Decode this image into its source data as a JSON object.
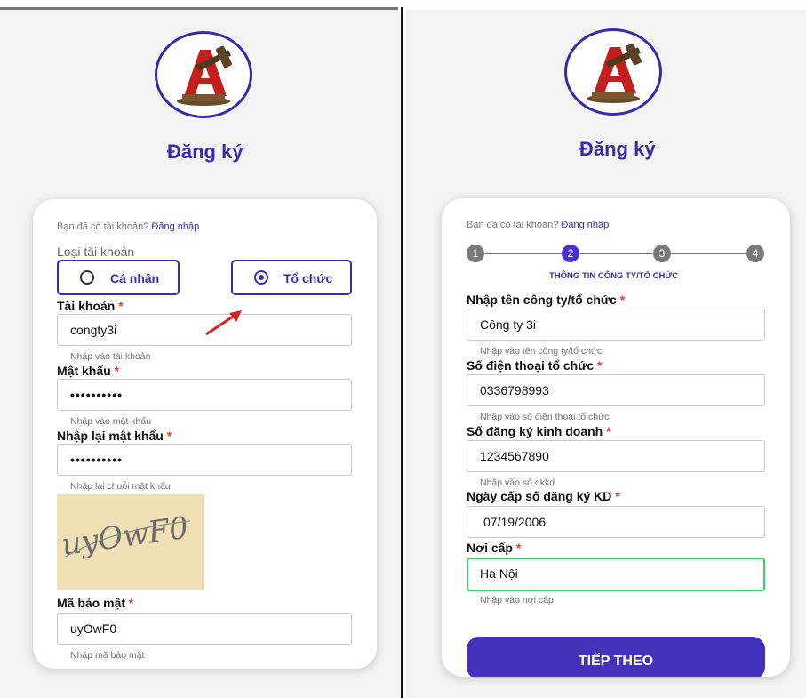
{
  "left": {
    "title": "Đăng ký",
    "login_prompt": "Bạn đã có tài khoản?",
    "login_link": "Đăng nhập",
    "account_type_label": "Loại tài khoản",
    "radio_individual": "Cá nhân",
    "radio_organization": "Tổ chức",
    "selected_account_type": "Tổ chức",
    "username_label": "Tài khoản",
    "username_value": "congty3i",
    "username_help": "Nhập vào tài khoản",
    "password_label": "Mật khẩu",
    "password_value": "••••••••••",
    "password_help": "Nhập vào mật khẩu",
    "confirm_label": "Nhập lại mật khẩu",
    "confirm_value": "••••••••••",
    "confirm_help": "Nhập lại chuỗi mật khẩu",
    "captcha_text": "uyOwF0",
    "security_label": "Mã bảo mật",
    "security_value": "uyOwF0",
    "security_help": "Nhập mã bảo mật",
    "required_mark": "*"
  },
  "right": {
    "title": "Đăng ký",
    "login_prompt": "Bạn đã có tài khoản?",
    "login_link": "Đăng nhập",
    "steps": [
      "1",
      "2",
      "3",
      "4"
    ],
    "active_step": "2",
    "step_caption": "THÔNG TIN CÔNG TY/TỔ CHỨC",
    "company_label": "Nhập tên công ty/tổ chức",
    "company_value": "Công ty 3i",
    "company_help": "Nhập vào tên công ty/tổ chức",
    "phone_label": "Số điện thoại tổ chức",
    "phone_value": "0336798993",
    "phone_help": "Nhập vào số điện thoại tổ chức",
    "bizreg_label": "Số đăng ký kinh doanh",
    "bizreg_value": "1234567890",
    "bizreg_help": "Nhập vào số dkkd",
    "issue_date_label": "Ngày cấp số đăng ký KD",
    "issue_date_value": "07/19/2006",
    "issue_place_label": "Nơi cấp",
    "issue_place_value": "Ha Nội",
    "issue_place_help": "Nhập vào nơi cấp",
    "next_button": "TIẾP THEO",
    "required_mark": "*"
  },
  "colors": {
    "brand": "#3a2aa8",
    "required": "#e53935",
    "focus_border": "#3bd06a",
    "annotation_arrow": "#e02020",
    "captcha_bg": "#f1dfb6"
  },
  "icons": [
    "logo-gavel-icon",
    "radio-icon",
    "red-arrow-annotation"
  ]
}
